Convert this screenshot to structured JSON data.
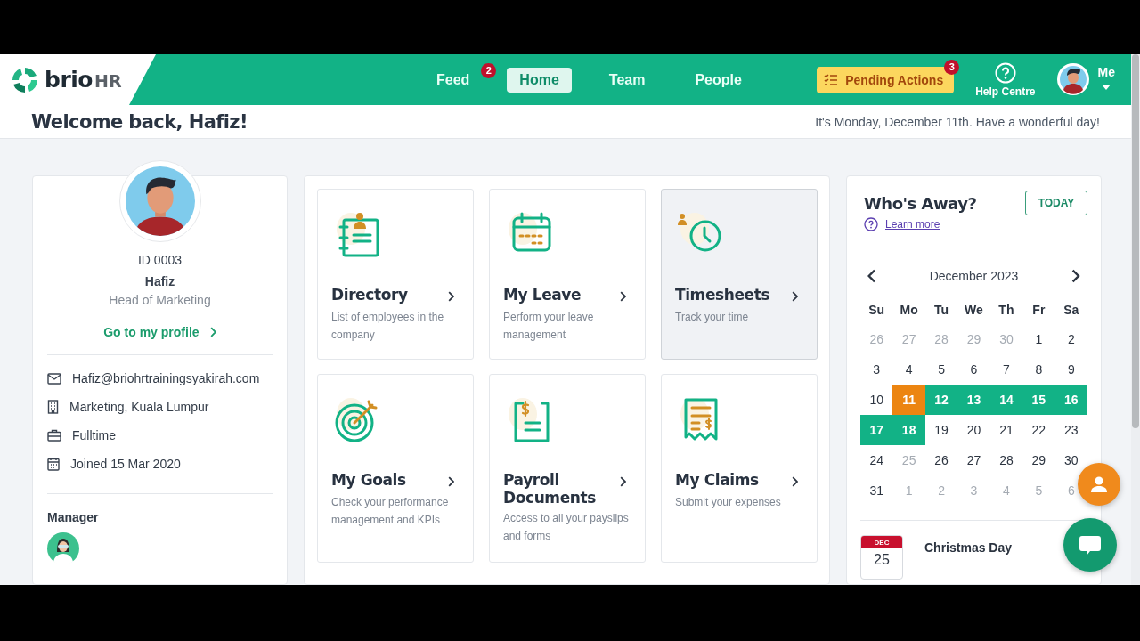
{
  "brand": {
    "name": "brio",
    "suffix": "HR"
  },
  "nav": [
    {
      "label": "Feed",
      "selected": false,
      "badge": "2"
    },
    {
      "label": "Home",
      "selected": true
    },
    {
      "label": "Team",
      "selected": false
    },
    {
      "label": "People",
      "selected": false
    }
  ],
  "pending": {
    "label": "Pending Actions",
    "badge": "3"
  },
  "help": {
    "label": "Help Centre"
  },
  "me": {
    "label": "Me"
  },
  "welcome": {
    "title": "Welcome back, Hafiz!",
    "greeting": "It's Monday, December 11th. Have a wonderful day!"
  },
  "profile": {
    "id": "ID 0003",
    "name": "Hafiz",
    "role": "Head of Marketing",
    "link": "Go to my profile",
    "details": [
      {
        "kind": "email",
        "text": "Hafiz@briohrtrainingsyakirah.com"
      },
      {
        "kind": "office",
        "text": "Marketing, Kuala Lumpur"
      },
      {
        "kind": "job",
        "text": "Fulltime"
      },
      {
        "kind": "joined",
        "text": "Joined 15 Mar 2020"
      }
    ],
    "manager_label": "Manager"
  },
  "tiles": [
    {
      "kind": "directory",
      "title": "Directory",
      "desc": "List of employees in the company",
      "selected": false
    },
    {
      "kind": "leave",
      "title": "My Leave",
      "desc": "Perform your leave management",
      "selected": false
    },
    {
      "kind": "timesheets",
      "title": "Timesheets",
      "desc": "Track your time",
      "selected": true
    },
    {
      "kind": "goals",
      "title": "My Goals",
      "desc": "Check your performance management and KPIs",
      "selected": false
    },
    {
      "kind": "payroll",
      "title": "Payroll Documents",
      "desc": "Access to all your payslips and forms",
      "selected": false
    },
    {
      "kind": "claims",
      "title": "My Claims",
      "desc": "Submit your expenses",
      "selected": false
    }
  ],
  "away": {
    "title": "Who's Away?",
    "today_button": "TODAY",
    "learn_more": "Learn more",
    "month": "December 2023",
    "weekdays": [
      "Su",
      "Mo",
      "Tu",
      "We",
      "Th",
      "Fr",
      "Sa"
    ],
    "days": [
      {
        "label": "26",
        "kind": "muted"
      },
      {
        "label": "27",
        "kind": "muted"
      },
      {
        "label": "28",
        "kind": "muted"
      },
      {
        "label": "29",
        "kind": "muted"
      },
      {
        "label": "30",
        "kind": "muted"
      },
      {
        "label": "1",
        "kind": "plain"
      },
      {
        "label": "2",
        "kind": "plain"
      },
      {
        "label": "3",
        "kind": "plain"
      },
      {
        "label": "4",
        "kind": "plain"
      },
      {
        "label": "5",
        "kind": "plain"
      },
      {
        "label": "6",
        "kind": "plain"
      },
      {
        "label": "7",
        "kind": "plain"
      },
      {
        "label": "8",
        "kind": "plain"
      },
      {
        "label": "9",
        "kind": "plain"
      },
      {
        "label": "10",
        "kind": "plain"
      },
      {
        "label": "11",
        "kind": "today"
      },
      {
        "label": "12",
        "kind": "away"
      },
      {
        "label": "13",
        "kind": "away"
      },
      {
        "label": "14",
        "kind": "away"
      },
      {
        "label": "15",
        "kind": "away"
      },
      {
        "label": "16",
        "kind": "away"
      },
      {
        "label": "17",
        "kind": "away"
      },
      {
        "label": "18",
        "kind": "away"
      },
      {
        "label": "19",
        "kind": "plain"
      },
      {
        "label": "20",
        "kind": "plain"
      },
      {
        "label": "21",
        "kind": "plain"
      },
      {
        "label": "22",
        "kind": "plain"
      },
      {
        "label": "23",
        "kind": "plain"
      },
      {
        "label": "24",
        "kind": "plain"
      },
      {
        "label": "25",
        "kind": "muted"
      },
      {
        "label": "26",
        "kind": "plain"
      },
      {
        "label": "27",
        "kind": "plain"
      },
      {
        "label": "28",
        "kind": "plain"
      },
      {
        "label": "29",
        "kind": "plain"
      },
      {
        "label": "30",
        "kind": "plain"
      },
      {
        "label": "31",
        "kind": "plain"
      },
      {
        "label": "1",
        "kind": "muted"
      },
      {
        "label": "2",
        "kind": "muted"
      },
      {
        "label": "3",
        "kind": "muted"
      },
      {
        "label": "4",
        "kind": "muted"
      },
      {
        "label": "5",
        "kind": "muted"
      },
      {
        "label": "6",
        "kind": "muted"
      }
    ],
    "event": {
      "month": "DEC",
      "day": "25",
      "name": "Christmas Day"
    }
  }
}
